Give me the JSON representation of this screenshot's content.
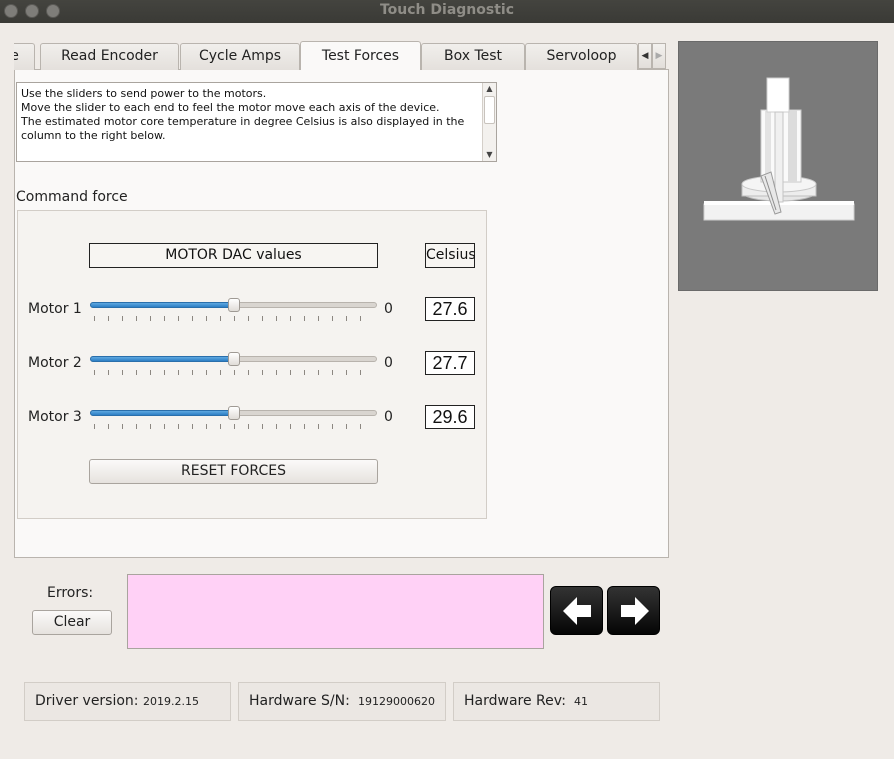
{
  "window": {
    "title": "Touch Diagnostic"
  },
  "tabs": [
    {
      "label": "e"
    },
    {
      "label": "Read Encoder"
    },
    {
      "label": "Cycle Amps"
    },
    {
      "label": "Test Forces",
      "active": true
    },
    {
      "label": "Box Test"
    },
    {
      "label": "Servoloop"
    }
  ],
  "tab_scroll": {
    "left": "◀",
    "right": "▶"
  },
  "info": {
    "text": "Use the sliders to send power to the motors.\nMove the slider to each end to feel the motor move each axis of the device.\nThe estimated motor core temperature in degree Celsius is also displayed in the\ncolumn to the right below."
  },
  "command_force": {
    "label": "Command force",
    "dac_header": "MOTOR DAC values",
    "celsius_header": "Celsius",
    "motors": [
      {
        "label": "Motor 1",
        "value": "0",
        "celsius": "27.6",
        "slider_fraction": 0.5
      },
      {
        "label": "Motor 2",
        "value": "0",
        "celsius": "27.7",
        "slider_fraction": 0.5
      },
      {
        "label": "Motor 3",
        "value": "0",
        "celsius": "29.6",
        "slider_fraction": 0.5
      }
    ],
    "reset_label": "RESET FORCES"
  },
  "errors": {
    "label": "Errors:",
    "clear_label": "Clear",
    "text": ""
  },
  "footer": {
    "driver_label": "Driver version:",
    "driver_value": "2019.2.15",
    "serial_label": "Hardware S/N:",
    "serial_value": "19129000620",
    "rev_label": "Hardware Rev:",
    "rev_value": "41"
  },
  "colors": {
    "error_bg": "#ffd1f6",
    "slider_fill": "#3a8fd4",
    "viewer_bg": "#7a7a7a"
  }
}
